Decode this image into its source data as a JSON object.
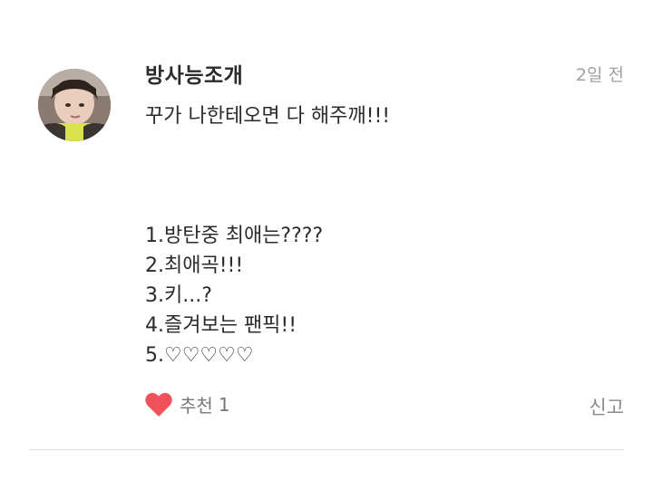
{
  "comment": {
    "author": "방사능조개",
    "timestamp": "2일 전",
    "avatar_icon": "profile-photo",
    "body_lines": [
      "꾸가 나한테오면 다 해주깨!!!",
      "",
      "",
      "",
      "1.방탄중 최애는????",
      "2.최애곡!!!",
      "3.키...?",
      "4.즐겨보는 팬픽!!",
      "5.♡♡♡♡♡"
    ],
    "like": {
      "icon": "heart-icon",
      "color": "#f0515a",
      "label": "추천",
      "count": "1"
    },
    "report_label": "신고"
  }
}
